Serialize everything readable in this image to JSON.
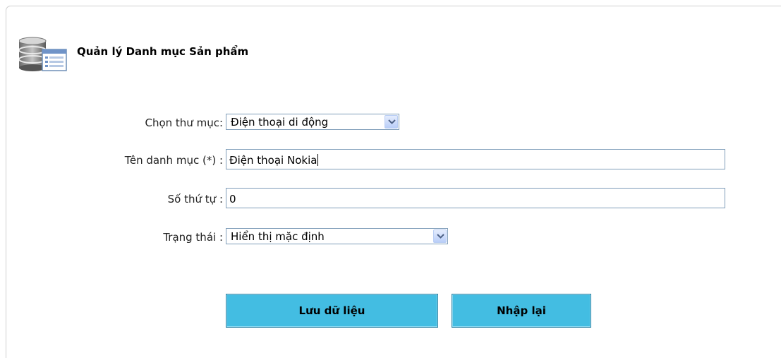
{
  "header": {
    "title": "Quản lý Danh mục Sản phẩm",
    "icon": "database-list-icon"
  },
  "form": {
    "folder": {
      "label": "Chọn thư mục:",
      "value": "Điện thoại di động"
    },
    "category_name": {
      "label": "Tên danh mục (*) :",
      "value": "Điện thoại Nokia"
    },
    "order": {
      "label": "Số thứ tự :",
      "value": "0"
    },
    "status": {
      "label": "Trạng thái :",
      "value": "Hiển thị mặc định"
    }
  },
  "buttons": {
    "save_label": "Lưu dữ liệu",
    "reset_label": "Nhập lại"
  },
  "colors": {
    "button_bg": "#43bde2",
    "field_border": "#7f9db9"
  }
}
